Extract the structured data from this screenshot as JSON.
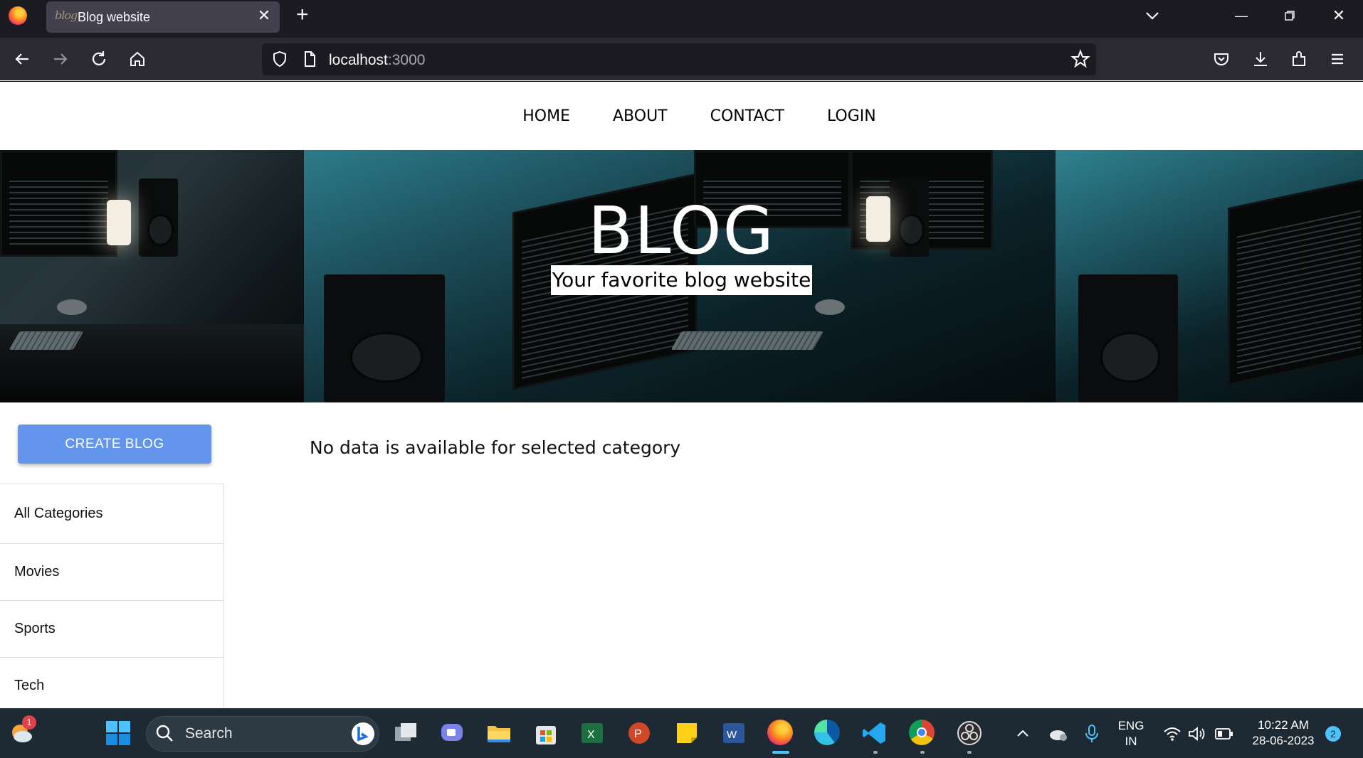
{
  "browser": {
    "tab_title": "Blog website",
    "tab_favicon_text": "blog",
    "url_host": "localhost",
    "url_port": ":3000",
    "icons": [
      "firefox-logo",
      "close-tab-icon",
      "new-tab-icon",
      "tab-list-icon",
      "minimize-icon",
      "restore-icon",
      "window-close-icon",
      "back-icon",
      "forward-icon",
      "reload-icon",
      "home-icon",
      "shield-icon",
      "page-icon",
      "bookmark-star-icon",
      "pocket-icon",
      "download-icon",
      "extensions-icon",
      "menu-icon"
    ]
  },
  "site": {
    "nav": [
      "HOME",
      "ABOUT",
      "CONTACT",
      "LOGIN"
    ],
    "hero_title": "BLOG",
    "hero_subtitle": "Your favorite blog website",
    "create_button": "CREATE BLOG",
    "categories": [
      "All Categories",
      "Movies",
      "Sports",
      "Tech"
    ],
    "empty_message": "No data is available for selected category",
    "accent_color": "#6495ed"
  },
  "taskbar": {
    "search_placeholder": "Search",
    "weather_badge": "1",
    "lang_top": "ENG",
    "lang_bottom": "IN",
    "time": "10:22 AM",
    "date": "28-06-2023",
    "notification_count": "2"
  }
}
